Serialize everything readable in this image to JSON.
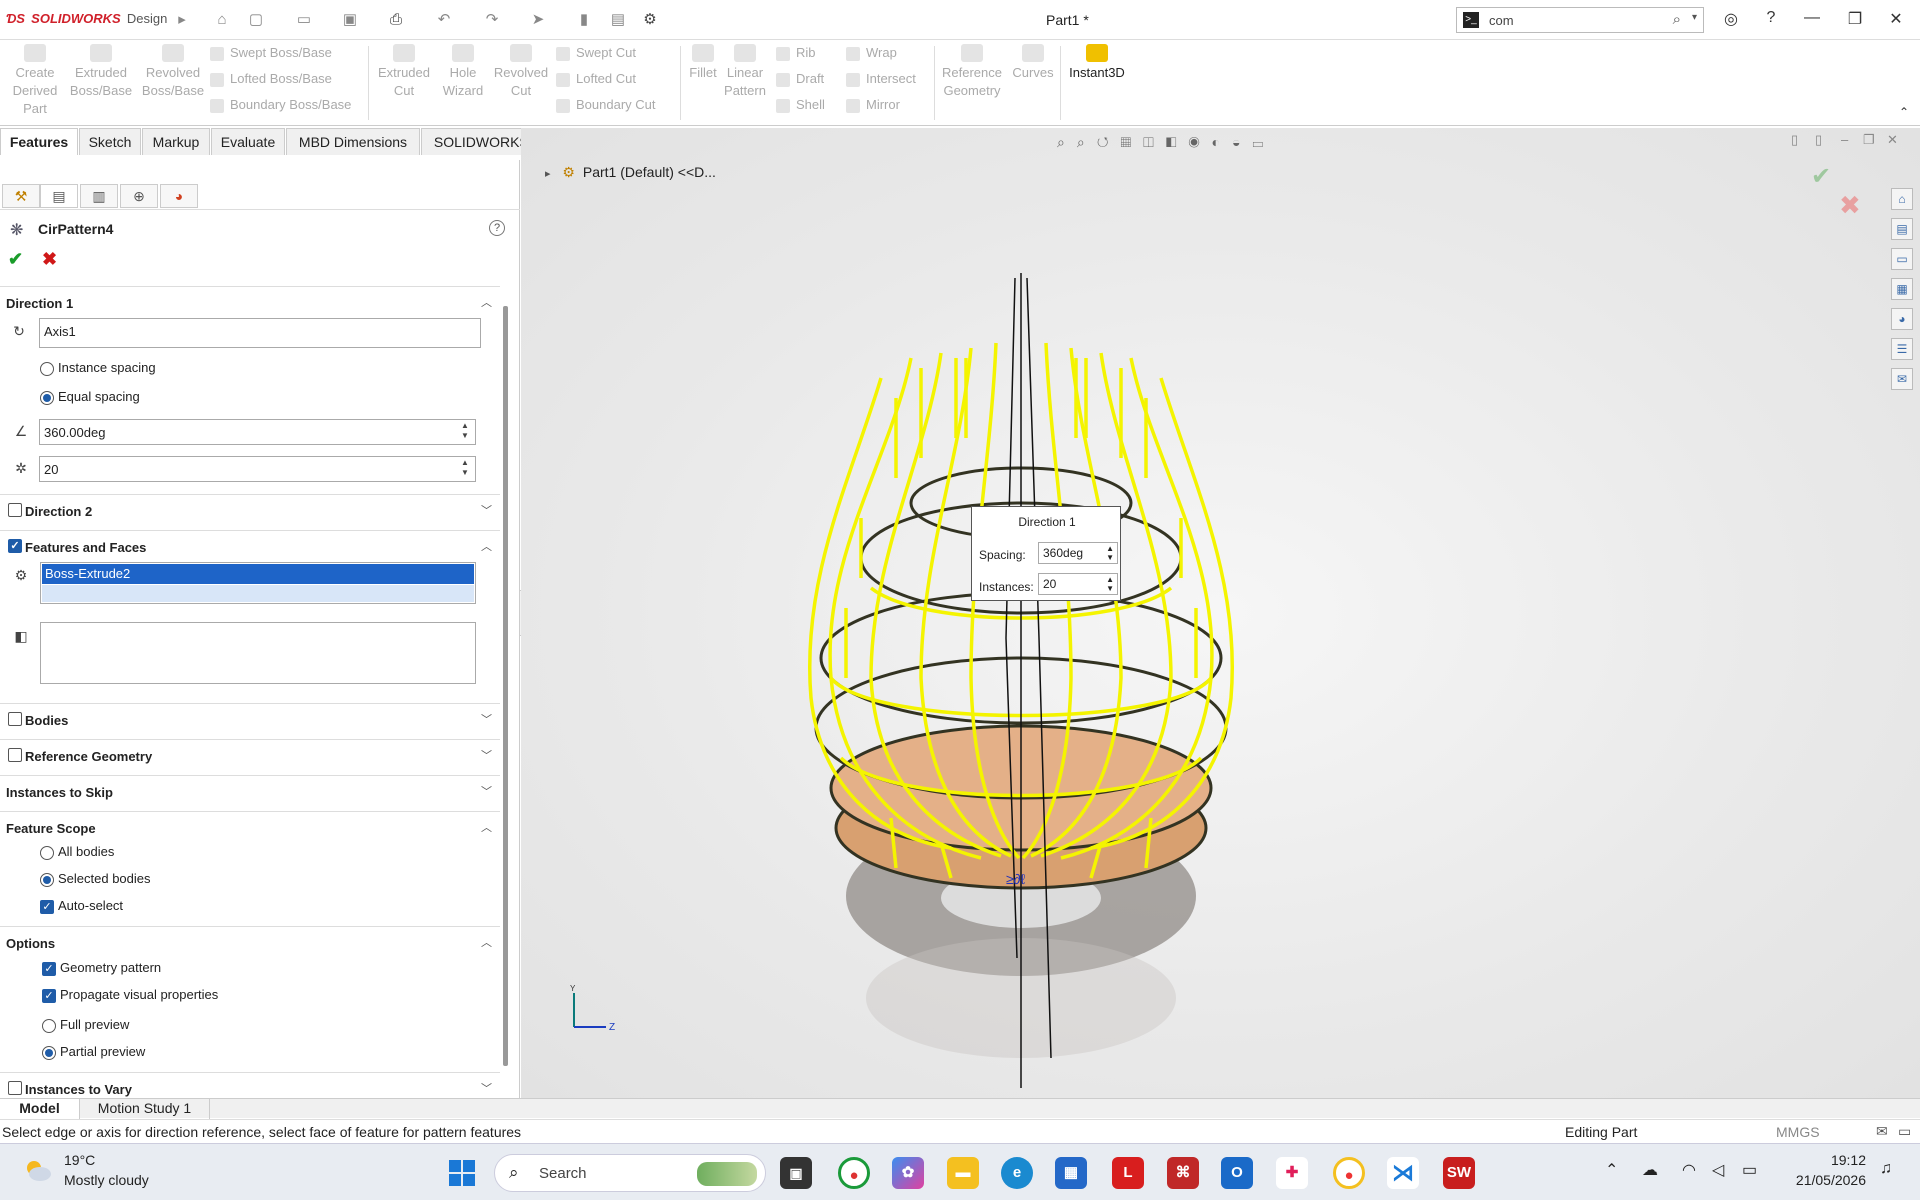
{
  "app": {
    "brand": "SOLIDWORKS",
    "brand_suffix": "Design",
    "document_title": "Part1 *",
    "search_value": "com"
  },
  "ribbon": {
    "create_derived_part": "Create Derived Part",
    "extruded_boss": "Extruded Boss/Base",
    "revolved_boss": "Revolved Boss/Base",
    "swept_boss": "Swept Boss/Base",
    "lofted_boss": "Lofted Boss/Base",
    "boundary_boss": "Boundary Boss/Base",
    "extruded_cut": "Extruded Cut",
    "hole_wizard": "Hole Wizard",
    "revolved_cut": "Revolved Cut",
    "swept_cut": "Swept Cut",
    "lofted_cut": "Lofted Cut",
    "boundary_cut": "Boundary Cut",
    "fillet": "Fillet",
    "linear_pattern": "Linear Pattern",
    "rib": "Rib",
    "draft": "Draft",
    "shell": "Shell",
    "wrap": "Wrap",
    "intersect": "Intersect",
    "mirror": "Mirror",
    "reference_geometry": "Reference Geometry",
    "curves": "Curves",
    "instant3d": "Instant3D"
  },
  "tabs": [
    "Features",
    "Sketch",
    "Markup",
    "Evaluate",
    "MBD Dimensions",
    "SOLIDWORKS Add-Ins"
  ],
  "property_manager": {
    "title": "CirPattern4",
    "direction1": {
      "header": "Direction 1",
      "axis": "Axis1",
      "instance_spacing": "Instance spacing",
      "equal_spacing": "Equal spacing",
      "angle": "360.00deg",
      "instances": "20"
    },
    "direction2": "Direction 2",
    "features_faces": {
      "header": "Features and Faces",
      "selected": "Boss-Extrude2"
    },
    "bodies": "Bodies",
    "reference_geometry": "Reference Geometry",
    "instances_to_skip": "Instances to Skip",
    "feature_scope": {
      "header": "Feature Scope",
      "all_bodies": "All bodies",
      "selected_bodies": "Selected bodies",
      "auto_select": "Auto-select"
    },
    "options": {
      "header": "Options",
      "geometry_pattern": "Geometry pattern",
      "propagate": "Propagate visual properties",
      "full_preview": "Full preview",
      "partial_preview": "Partial preview"
    },
    "instances_to_vary": "Instances to Vary"
  },
  "viewport": {
    "tree_node": "Part1 (Default) <<D...",
    "popup": {
      "title": "Direction 1",
      "spacing_label": "Spacing:",
      "spacing_value": "360deg",
      "instances_label": "Instances:",
      "instances_value": "20"
    },
    "triad_y": "Y",
    "triad_z": "Z"
  },
  "bottom_tabs": [
    "Model",
    "Motion Study 1"
  ],
  "status": {
    "message": "Select edge or axis for direction reference, select face of feature for pattern features",
    "mode": "Editing Part",
    "units": "MMGS"
  },
  "taskbar": {
    "temperature": "19°C",
    "condition": "Mostly cloudy",
    "search": "Search",
    "time": "19:12",
    "date": "21/05/2026"
  },
  "colors": {
    "accent": "#1f5ca8",
    "brand": "#d0202a",
    "preview": "#ffff00"
  }
}
